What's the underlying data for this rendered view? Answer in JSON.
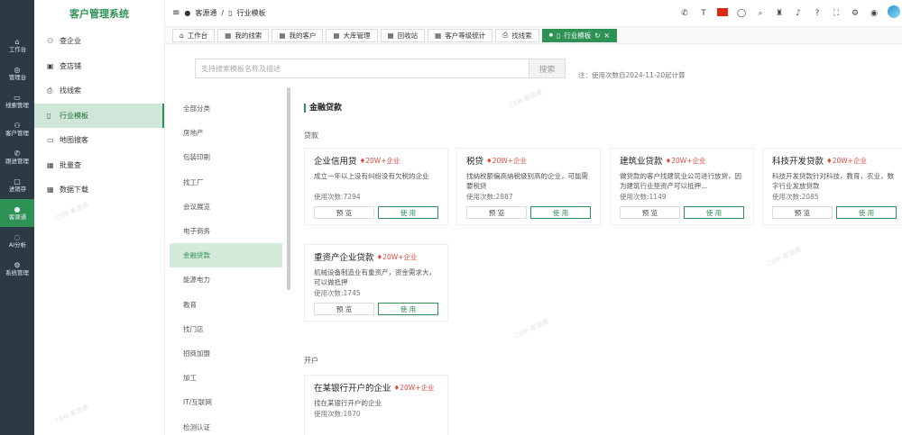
{
  "rail": [
    {
      "label": "工作台",
      "icon": "home-icon",
      "glyph": "⌂"
    },
    {
      "label": "管理台",
      "icon": "dashboard-icon",
      "glyph": "◎"
    },
    {
      "label": "线索管理",
      "icon": "clue-icon",
      "glyph": "▭"
    },
    {
      "label": "客户管理",
      "icon": "customer-icon",
      "glyph": "⚇"
    },
    {
      "label": "跟进管理",
      "icon": "followup-icon",
      "glyph": "✆"
    },
    {
      "label": "进销存",
      "icon": "inventory-icon",
      "glyph": "▢"
    },
    {
      "label": "客源通",
      "icon": "user-icon",
      "glyph": "●"
    },
    {
      "label": "AI分析",
      "icon": "ai-icon",
      "glyph": "◌"
    },
    {
      "label": "系统管理",
      "icon": "system-icon",
      "glyph": "⚙"
    }
  ],
  "menu": {
    "title": "客户管理系统",
    "items": [
      {
        "label": "查企业",
        "glyph": "⚇"
      },
      {
        "label": "查店铺",
        "glyph": "▣"
      },
      {
        "label": "找线索",
        "glyph": "⎙"
      },
      {
        "label": "行业模板",
        "glyph": "▯"
      },
      {
        "label": "地图搜客",
        "glyph": "▭"
      },
      {
        "label": "批量查",
        "glyph": "▦"
      },
      {
        "label": "数据下载",
        "glyph": "▦"
      }
    ]
  },
  "header": {
    "crumb1": "客源通",
    "sep": "/",
    "crumb2": "行业模板"
  },
  "tabs": [
    {
      "label": "工作台",
      "glyph": "⌂"
    },
    {
      "label": "我的线索",
      "glyph": "▦"
    },
    {
      "label": "我的客户",
      "glyph": "▦"
    },
    {
      "label": "大库管理",
      "glyph": "▦"
    },
    {
      "label": "回收站",
      "glyph": "▦"
    },
    {
      "label": "客户等级统计",
      "glyph": "▦"
    },
    {
      "label": "找线索",
      "glyph": "⎙"
    },
    {
      "label": "行业模板",
      "glyph": "▯"
    }
  ],
  "search": {
    "placeholder": "支持搜索模板名称及描述",
    "button": "搜索",
    "note": "注：使用次数自2024-11-20起计算"
  },
  "categories": [
    "全部分类",
    "房地产",
    "包装印刷",
    "找工厂",
    "会议展览",
    "电子商务",
    "金融贷款",
    "能源电力",
    "教育",
    "找门店",
    "招商加盟",
    "加工",
    "IT/互联网",
    "检测认证"
  ],
  "section_title": "金融贷款",
  "groups": [
    "贷款",
    "开户"
  ],
  "badge": "20W+企业",
  "btn_preview": "预 览",
  "btn_use": "使 用",
  "cards": [
    {
      "title": "企业信用贷",
      "desc": "成立一年以上没有纠纷没有欠税的企业",
      "uses": "使用次数:7294"
    },
    {
      "title": "税贷",
      "desc": "找纳税额偏高纳税级别高的企业，可能需要税贷",
      "uses": "使用次数:2887"
    },
    {
      "title": "建筑业贷款",
      "desc": "做贷款的客户找建筑业公司进行放贷，因为建筑行业垫资产可以抵押...",
      "uses": "使用次数:1149"
    },
    {
      "title": "科技开发贷款",
      "desc": "科技开发贷款针对科技，教育，农业，数字行业发放贷款",
      "uses": "使用次数:2085"
    },
    {
      "title": "重资产企业贷款",
      "desc": "机械设备制造业有重资产，资金需求大，可以做抵押",
      "uses": "使用次数:1745"
    },
    {
      "title": "在某银行开户的企业",
      "desc": "找在某银行开户的企业",
      "uses": "使用次数:1870"
    }
  ],
  "watermark": "CRM-客源通",
  "colors": {
    "accent": "#2f9255",
    "rail": "#2b3a45",
    "badge": "#e04a3f"
  }
}
